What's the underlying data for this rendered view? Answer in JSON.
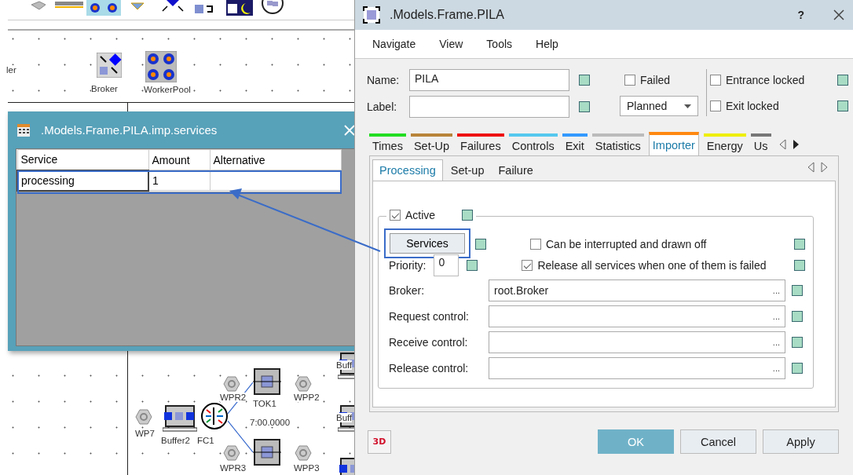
{
  "canvas": {
    "labels": [
      "ler",
      "Broker",
      "WorkerPool",
      "WP7",
      "Buffer2",
      "FC1",
      "WPR2",
      "TOK1",
      "WPP2",
      "7:00.0000",
      "WPR3",
      "WPP3",
      "Buff",
      "Buff"
    ]
  },
  "services_window": {
    "title": ".Models.Frame.PILA.imp.services",
    "columns": [
      "Service",
      "Amount",
      "Alternative"
    ],
    "rows": [
      {
        "cells": [
          "processing",
          "1"
        ]
      }
    ]
  },
  "dialog": {
    "title": ".Models.Frame.PILA",
    "help": "?",
    "menu": [
      "Navigate",
      "View",
      "Tools",
      "Help"
    ],
    "name": {
      "label": "Name:",
      "value": "PILA"
    },
    "label_field": {
      "label": "Label:"
    },
    "failed": {
      "label": "Failed",
      "checked": false
    },
    "status_dropdown": "Planned",
    "entrance_locked": {
      "label": "Entrance locked",
      "checked": false
    },
    "exit_locked": {
      "label": "Exit locked",
      "checked": false
    },
    "tabs": [
      {
        "label": "Times",
        "color": "#22dd22",
        "selected": false
      },
      {
        "label": "Set-Up",
        "color": "#b8843a",
        "selected": false
      },
      {
        "label": "Failures",
        "color": "#ee1111",
        "selected": false
      },
      {
        "label": "Controls",
        "color": "#55c8ee",
        "selected": false
      },
      {
        "label": "Exit",
        "color": "#3399ff",
        "selected": false
      },
      {
        "label": "Statistics",
        "color": "#bbbbbb",
        "selected": false
      },
      {
        "label": "Importer",
        "color": "#ff8811",
        "selected": true
      },
      {
        "label": "Energy",
        "color": "#eeee00",
        "selected": false
      },
      {
        "label": "Us",
        "color": "#777777",
        "selected": false
      }
    ],
    "subtabs": [
      {
        "label": "Processing",
        "selected": true
      },
      {
        "label": "Set-up",
        "selected": false
      },
      {
        "label": "Failure",
        "selected": false
      }
    ],
    "active": {
      "label": "Active",
      "checked": true
    },
    "services_button": "Services",
    "can_interrupt": {
      "label": "Can be interrupted and drawn off",
      "checked": false
    },
    "release_all": {
      "label": "Release all services when one of them is failed",
      "checked": true
    },
    "priority": {
      "label": "Priority:",
      "value": "0"
    },
    "fields": [
      {
        "label": "Broker:",
        "value": "root.Broker",
        "browse": "..."
      },
      {
        "label": "Request control:",
        "browse": "..."
      },
      {
        "label": "Receive control:",
        "browse": "..."
      },
      {
        "label": "Release control:",
        "browse": "..."
      }
    ],
    "three_d": "3D",
    "buttons": [
      {
        "label": "OK",
        "kind": "primary"
      },
      {
        "label": "Cancel",
        "kind": "normal"
      },
      {
        "label": "Apply",
        "kind": "normal"
      }
    ]
  }
}
